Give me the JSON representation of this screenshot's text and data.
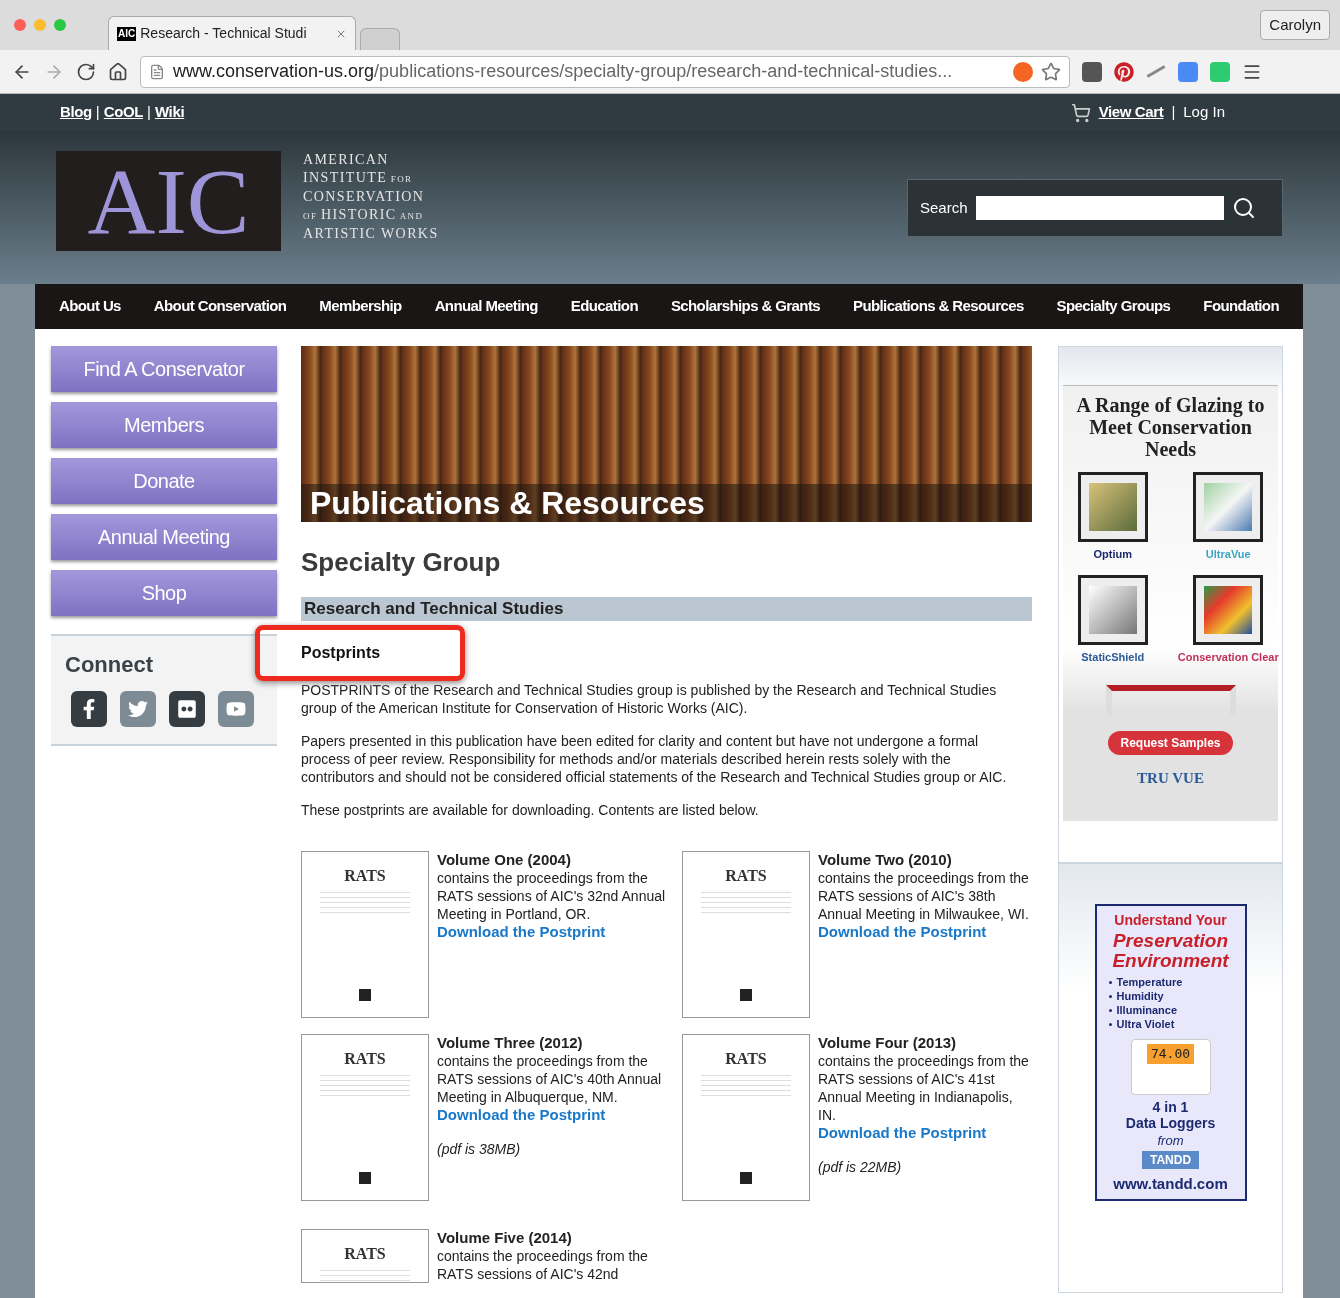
{
  "browser": {
    "tabs": [
      {
        "title": "Research - Technical Studi",
        "favicon": "AIC",
        "selected": true
      },
      {
        "selected": false
      }
    ],
    "profile": "Carolyn",
    "url_host": "www.conservation-us.org",
    "url_path": "/publications-resources/specialty-group/research-and-technical-studies..."
  },
  "utility_links": [
    "Blog",
    "CoOL",
    "Wiki"
  ],
  "separator": "|",
  "cart": "View Cart",
  "login": "Log In",
  "logo": {
    "mark": "AIC",
    "lines": [
      {
        "text": "AMERICAN"
      },
      {
        "text": "INSTITUTE",
        "suffix": "FOR"
      },
      {
        "text": "CONSERVATION"
      },
      {
        "prefix": "OF",
        "text": "HISTORIC",
        "suffix": "AND"
      },
      {
        "text": "ARTISTIC WORKS"
      }
    ]
  },
  "search": {
    "label": "Search"
  },
  "nav": [
    "About Us",
    "About Conservation",
    "Membership",
    "Annual Meeting",
    "Education",
    "Scholarships & Grants",
    "Publications & Resources",
    "Specialty Groups",
    "Foundation"
  ],
  "sidebar_buttons": [
    "Find A Conservator",
    "Members",
    "Donate",
    "Annual Meeting",
    "Shop"
  ],
  "connect": {
    "title": "Connect",
    "icons": [
      {
        "kind": "facebook",
        "dark": true
      },
      {
        "kind": "twitter",
        "dark": false
      },
      {
        "kind": "flickr",
        "dark": true
      },
      {
        "kind": "youtube",
        "dark": false
      }
    ]
  },
  "hero_title": "Publications & Resources",
  "page_title": "Specialty Group",
  "section_bar": "Research and Technical Studies",
  "subheading": {
    "text": "Postprints",
    "highlighted": true
  },
  "paragraphs": [
    "POSTPRINTS of the Research and Technical Studies group is published by the Research and Technical Studies group of the American Institute for Conservation of Historic Works (AIC).",
    "Papers presented in this publication have been edited for clarity and content but have not undergone a formal process of peer review. Responsibility for methods and/or materials described herein rests solely with the contributors and should not be considered official statements of the Research and Technical Studies group or AIC.",
    "These postprints are available for downloading. Contents are listed below."
  ],
  "volumes": [
    {
      "cover": "RATS",
      "title": "Volume One (2004)",
      "description": "contains the proceedings from the RATS sessions of AIC's 32nd Annual Meeting in Portland, OR.",
      "link": "Download the Postprint"
    },
    {
      "cover": "RATS",
      "title": "Volume Two (2010)",
      "description": "contains the proceedings from the RATS sessions of AIC's 38th Annual Meeting in Milwaukee, WI.",
      "link": "Download the Postprint"
    },
    {
      "cover": "RATS",
      "title": "Volume Three (2012)",
      "description": "contains the proceedings from the RATS sessions of AIC's 40th Annual Meeting in Albuquerque, NM.",
      "link": "Download the Postprint",
      "note": "(pdf is 38MB)"
    },
    {
      "cover": "RATS",
      "title": "Volume Four (2013)",
      "description": "contains the proceedings from the RATS sessions of AIC's 41st Annual Meeting in Indianapolis, IN.",
      "link": "Download the Postprint",
      "note": "(pdf is 22MB)"
    },
    {
      "cover": "RATS",
      "title": "Volume Five (2014)",
      "description": "contains the proceedings from the RATS sessions of AIC's 42nd"
    }
  ],
  "ad_glazing": {
    "title": "A Range of Glazing to Meet Conservation Needs",
    "products": [
      {
        "name": "Optium",
        "color": "#1b2a6b"
      },
      {
        "name": "UltraVue",
        "color": "#3aa6c4"
      },
      {
        "name": "StaticShield",
        "color": "#2a5a9a"
      },
      {
        "name": "Conservation Clear",
        "color": "#c0305a"
      }
    ],
    "button": "Request Samples",
    "brand": "TRU VUE"
  },
  "ad_logger": {
    "line1": "Understand Your",
    "line2": "Preservation Environment",
    "bullets": [
      "Temperature",
      "Humidity",
      "Illuminance",
      "Ultra Violet"
    ],
    "display": "74.00",
    "count": "4 in 1",
    "product": "Data Loggers",
    "from": "from",
    "brand": "TANDD",
    "url": "www.tandd.com"
  }
}
